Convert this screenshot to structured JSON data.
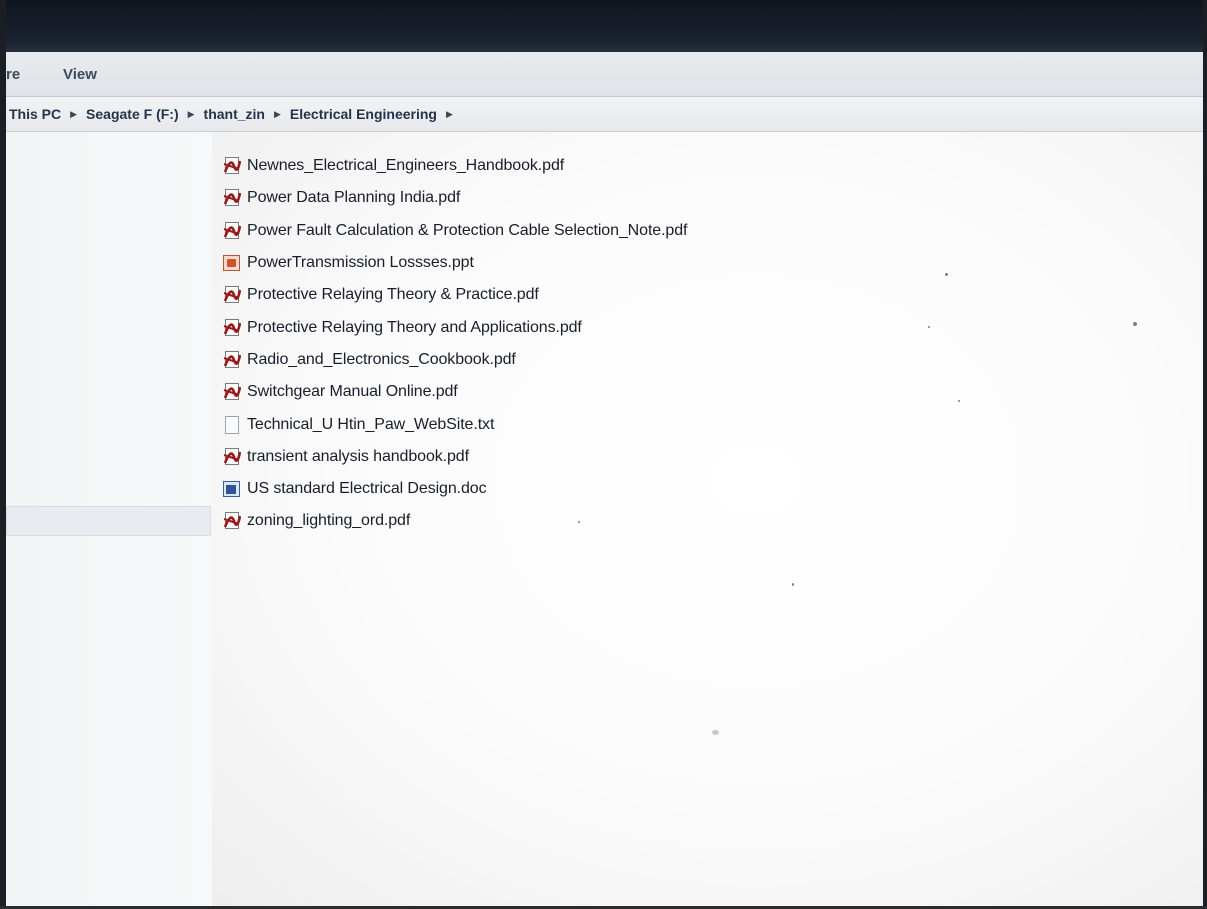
{
  "ribbon": {
    "tabs": [
      "re",
      "View"
    ]
  },
  "address": {
    "crumbs": [
      "This PC",
      "Seagate F (F:)",
      "thant_zin",
      "Electrical Engineering"
    ]
  },
  "files": [
    {
      "name": "Newnes_Electrical_Engineers_Handbook.pdf",
      "icon": "pdf"
    },
    {
      "name": "Power Data Planning India.pdf",
      "icon": "pdf"
    },
    {
      "name": "Power Fault Calculation & Protection Cable Selection_Note.pdf",
      "icon": "pdf"
    },
    {
      "name": "PowerTransmission Lossses.ppt",
      "icon": "ppt"
    },
    {
      "name": "Protective Relaying Theory & Practice.pdf",
      "icon": "pdf"
    },
    {
      "name": "Protective Relaying Theory and Applications.pdf",
      "icon": "pdf"
    },
    {
      "name": "Radio_and_Electronics_Cookbook.pdf",
      "icon": "pdf"
    },
    {
      "name": "Switchgear Manual Online.pdf",
      "icon": "pdf"
    },
    {
      "name": "Technical_U Htin_Paw_WebSite.txt",
      "icon": "txt"
    },
    {
      "name": "transient analysis handbook.pdf",
      "icon": "pdf"
    },
    {
      "name": "US standard Electrical Design.doc",
      "icon": "doc"
    },
    {
      "name": "zoning_lighting_ord.pdf",
      "icon": "pdf"
    }
  ],
  "colors": {
    "pdf_icon": "#9b1b1b",
    "ppt_icon": "#d2512c",
    "doc_icon": "#2b579a",
    "title_bar": "#141b26"
  }
}
